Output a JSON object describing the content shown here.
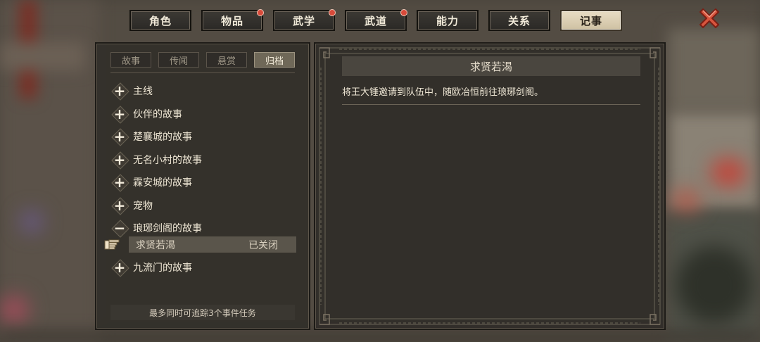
{
  "tabs": [
    {
      "label": "角色",
      "badge": false,
      "active": false
    },
    {
      "label": "物品",
      "badge": true,
      "active": false
    },
    {
      "label": "武学",
      "badge": true,
      "active": false
    },
    {
      "label": "武道",
      "badge": true,
      "active": false
    },
    {
      "label": "能力",
      "badge": false,
      "active": false
    },
    {
      "label": "关系",
      "badge": false,
      "active": false
    },
    {
      "label": "记事",
      "badge": false,
      "active": true
    }
  ],
  "subtabs": [
    {
      "label": "故事",
      "active": false
    },
    {
      "label": "传闻",
      "active": false
    },
    {
      "label": "悬赏",
      "active": false
    },
    {
      "label": "归档",
      "active": true
    }
  ],
  "groups": [
    {
      "label": "主线",
      "toggle": "+"
    },
    {
      "label": "伙伴的故事",
      "toggle": "+"
    },
    {
      "label": "楚襄城的故事",
      "toggle": "+"
    },
    {
      "label": "无名小村的故事",
      "toggle": "+"
    },
    {
      "label": "霖安城的故事",
      "toggle": "+"
    },
    {
      "label": "宠物",
      "toggle": "+"
    },
    {
      "label": "琅琊剑阁的故事",
      "toggle": "−"
    },
    {
      "label": "九流门的故事",
      "toggle": "+"
    }
  ],
  "selected_quest": {
    "name": "求贤若渴",
    "status": "已关闭"
  },
  "footer_note": "最多同时可追踪3个事件任务",
  "detail": {
    "title": "求贤若渴",
    "description": "将王大锤邀请到队伍中，随欧冶恒前往琅琊剑阁。"
  },
  "colors": {
    "accent_active_tab": "#e0d4b8",
    "badge": "#d84a3a",
    "close": "#d8553e"
  }
}
